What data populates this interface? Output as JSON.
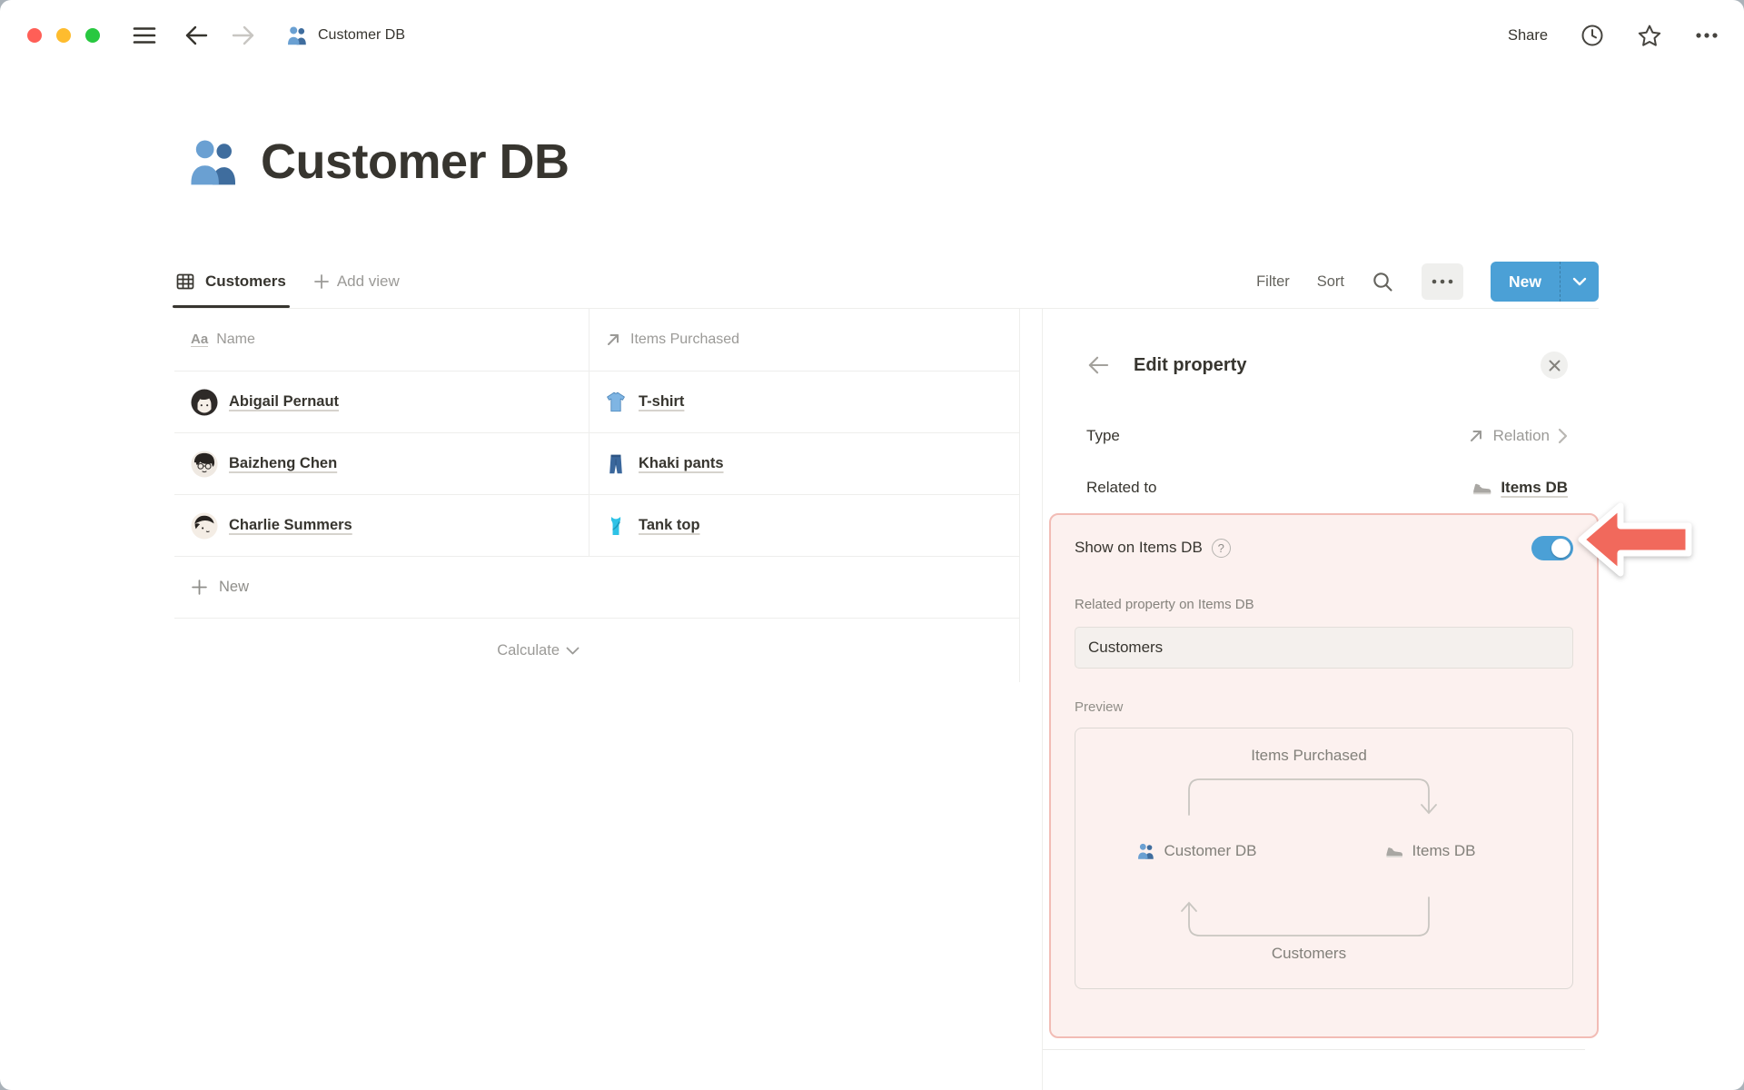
{
  "topbar": {
    "breadcrumb": "Customer DB",
    "share_label": "Share"
  },
  "page": {
    "title": "Customer DB"
  },
  "view_bar": {
    "active_tab": "Customers",
    "add_view_label": "Add view",
    "filter_label": "Filter",
    "sort_label": "Sort",
    "new_button_label": "New"
  },
  "table": {
    "columns": [
      {
        "label": "Name"
      },
      {
        "label": "Items Purchased"
      }
    ],
    "rows": [
      {
        "name": "Abigail Pernaut",
        "item": "T-shirt"
      },
      {
        "name": "Baizheng Chen",
        "item": "Khaki pants"
      },
      {
        "name": "Charlie Summers",
        "item": "Tank top"
      }
    ],
    "new_row_label": "New",
    "calculate_label": "Calculate"
  },
  "panel": {
    "title": "Edit property",
    "type_label": "Type",
    "type_value": "Relation",
    "related_to_label": "Related to",
    "related_to_value": "Items DB",
    "highlight": {
      "show_toggle_label": "Show on Items DB",
      "toggle_state": "on",
      "related_property_label": "Related property on Items DB",
      "related_property_value": "Customers",
      "preview_label": "Preview",
      "preview": {
        "top_label": "Items Purchased",
        "left_node": "Customer DB",
        "right_node": "Items DB",
        "bottom_label": "Customers"
      }
    }
  },
  "icons": {
    "title_property_glyph": "Aa",
    "help_glyph": "?",
    "names": [
      "people-icon",
      "table-view-icon",
      "relation-arrow-icon",
      "sneaker-icon",
      "tshirt-icon",
      "jeans-icon",
      "tank-top-icon",
      "search-icon",
      "clock-icon",
      "star-icon",
      "ellipsis-icon",
      "hamburger-icon",
      "back-icon",
      "forward-icon",
      "close-icon",
      "chevron-down-icon",
      "chevron-right-icon",
      "plus-icon",
      "toggle-on",
      "red-pointer-arrow"
    ]
  },
  "colors": {
    "accent_blue": "#4BA0D6",
    "highlight_bg": "#FCF1EF",
    "highlight_border": "#F2BCB5",
    "arrow_red": "#F1695C",
    "text_primary": "#37352f",
    "text_muted": "#9b9a97"
  }
}
